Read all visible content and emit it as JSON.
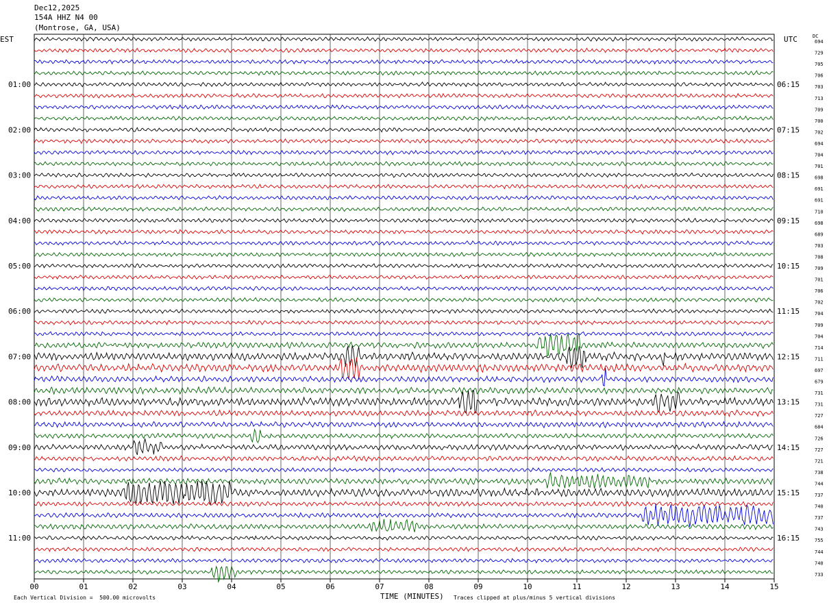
{
  "header": {
    "date": "Dec12,2025",
    "station": "154A HHZ N4 00",
    "location": "(Montrose, GA, USA)"
  },
  "left_tz": "EST",
  "right_tz": "UTC",
  "dc_label": "DC",
  "footer": {
    "left": "Each Vertical Division =  500.00 microvolts",
    "right": "Traces clipped at plus/minus 5 vertical divisions",
    "xlabel": "TIME (MINUTES)"
  },
  "chart_data": {
    "type": "helicorder",
    "xlabel": "TIME (MINUTES)",
    "xlim": [
      0,
      15
    ],
    "x_ticks": [
      "00",
      "01",
      "02",
      "03",
      "04",
      "05",
      "06",
      "07",
      "08",
      "09",
      "10",
      "11",
      "12",
      "13",
      "14",
      "15"
    ],
    "trace_colors": [
      "#000000",
      "#dd0000",
      "#0000dd",
      "#006600"
    ],
    "left_hour_labels": [
      "01:00",
      "02:00",
      "03:00",
      "04:00",
      "05:00",
      "06:00",
      "07:00",
      "08:00",
      "09:00",
      "10:00",
      "11:00"
    ],
    "right_hour_labels": [
      "06:15",
      "07:15",
      "08:15",
      "09:15",
      "10:15",
      "11:15",
      "12:15",
      "13:15",
      "14:15",
      "15:15",
      "16:15"
    ],
    "dc_offsets": [
      694,
      729,
      705,
      706,
      703,
      713,
      709,
      700,
      702,
      694,
      704,
      701,
      698,
      691,
      691,
      710,
      698,
      689,
      703,
      708,
      709,
      701,
      706,
      702,
      704,
      709,
      704,
      714,
      711,
      697,
      679,
      731,
      731,
      727,
      684,
      726,
      727,
      721,
      738,
      744,
      737,
      740,
      737,
      743,
      755,
      744,
      740,
      733
    ],
    "trace_amplitude": [
      1,
      1,
      1,
      1,
      1,
      1,
      1,
      1,
      1,
      1,
      1,
      1,
      1,
      1,
      1,
      1,
      1,
      1,
      1,
      1,
      1,
      1,
      1,
      1,
      1,
      1,
      1,
      1.5,
      2,
      2,
      1.5,
      1.6,
      2,
      1.5,
      1.4,
      1.2,
      1.4,
      1.2,
      1,
      1.5,
      2,
      1.2,
      1.2,
      1.3,
      1,
      1,
      1,
      1
    ],
    "events": [
      {
        "trace": 27,
        "minute_start": 10.2,
        "minute_end": 11.1,
        "relative_amplitude": 3
      },
      {
        "trace": 28,
        "minute_start": 6.3,
        "minute_end": 6.6,
        "relative_amplitude": 2.5
      },
      {
        "trace": 28,
        "minute_start": 10.8,
        "minute_end": 11.2,
        "relative_amplitude": 2.5
      },
      {
        "trace": 28,
        "minute_start": 12.7,
        "minute_end": 12.8,
        "relative_amplitude": 3
      },
      {
        "trace": 29,
        "minute_start": 6.2,
        "minute_end": 6.6,
        "relative_amplitude": 2.5
      },
      {
        "trace": 30,
        "minute_start": 11.5,
        "minute_end": 11.6,
        "relative_amplitude": 3
      },
      {
        "trace": 32,
        "minute_start": 8.6,
        "minute_end": 9.0,
        "relative_amplitude": 2.5
      },
      {
        "trace": 32,
        "minute_start": 12.5,
        "minute_end": 13.1,
        "relative_amplitude": 2
      },
      {
        "trace": 35,
        "minute_start": 4.4,
        "minute_end": 4.6,
        "relative_amplitude": 2.5
      },
      {
        "trace": 36,
        "minute_start": 2.0,
        "minute_end": 2.6,
        "relative_amplitude": 2
      },
      {
        "trace": 39,
        "minute_start": 10.4,
        "minute_end": 12.5,
        "relative_amplitude": 1.8
      },
      {
        "trace": 40,
        "minute_start": 1.8,
        "minute_end": 4.0,
        "relative_amplitude": 2.3
      },
      {
        "trace": 42,
        "minute_start": 12.3,
        "minute_end": 15.0,
        "relative_amplitude": 3
      },
      {
        "trace": 43,
        "minute_start": 6.8,
        "minute_end": 7.8,
        "relative_amplitude": 1.8
      },
      {
        "trace": 47,
        "minute_start": 3.6,
        "minute_end": 4.1,
        "relative_amplitude": 3
      }
    ]
  }
}
